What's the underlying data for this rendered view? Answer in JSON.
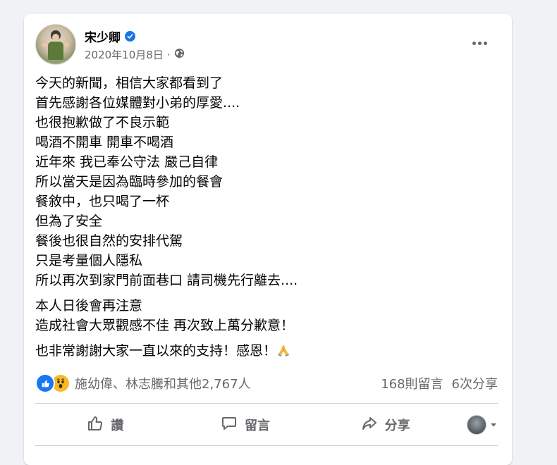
{
  "post": {
    "author": "宋少卿",
    "date": "2020年10月8日",
    "meta_separator": "·",
    "paragraphs": [
      {
        "lines": [
          "今天的新聞，相信大家都看到了",
          "首先感謝各位媒體對小弟的厚愛....",
          "也很抱歉做了不良示範",
          "喝酒不開車 開車不喝酒",
          "近年來 我已奉公守法 嚴己自律",
          "所以當天是因為臨時參加的餐會",
          "餐敘中，也只喝了一杯",
          "但為了安全",
          "餐後也很自然的安排代駕",
          "只是考量個人隱私",
          "所以再次到家門前面巷口 請司機先行離去...."
        ]
      },
      {
        "lines": [
          "本人日後會再注意",
          "造成社會大眾觀感不佳 再次致上萬分歉意！"
        ]
      },
      {
        "lines": [
          "也非常謝謝大家一直以來的支持！感恩！"
        ]
      }
    ],
    "reactions_text": "施幼偉、林志騰和其他2,767人",
    "comments_count": "168則留言",
    "shares_count": "6次分享"
  },
  "actions": {
    "like_label": "讚",
    "comment_label": "留言",
    "share_label": "分享"
  },
  "icons": {
    "verified": "verified-badge-icon",
    "privacy": "globe-icon",
    "more": "more-options-icon",
    "like_reaction": "like-reaction-icon",
    "wow_reaction": "wow-reaction-icon",
    "pray": "folded-hands-emoji",
    "like_action": "thumbs-up-icon",
    "comment_action": "comment-bubble-icon",
    "share_action": "share-arrow-icon",
    "dropdown": "caret-down-icon"
  },
  "colors": {
    "page_bg": "#f0f2f5",
    "card_bg": "#ffffff",
    "primary_text": "#050505",
    "secondary_text": "#65676b",
    "brand_blue": "#1877f2",
    "verified_blue": "#1b74e4",
    "wow_yellow": "#f7b928",
    "divider": "#ced0d4"
  }
}
